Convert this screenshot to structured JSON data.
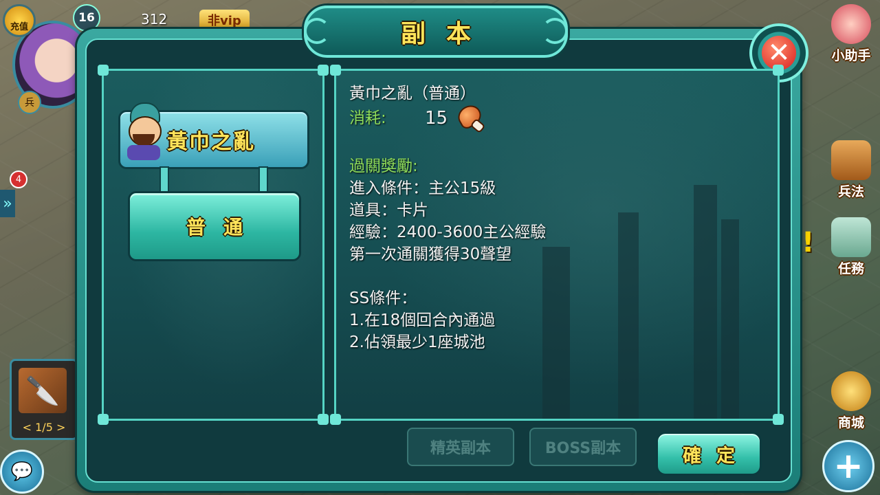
{
  "hud": {
    "recharge_label": "充值",
    "level": "16",
    "gold": "312",
    "vip_label": "非vip",
    "soldier_label": "兵",
    "badge_count": "4",
    "weapon_pager": "< 1/5 >",
    "right_items": {
      "helper": "小助手",
      "tactics": "兵法",
      "quest": "任務",
      "shop": "商城"
    }
  },
  "dialog": {
    "title": "副本",
    "close_label": "✕",
    "dungeon": {
      "name": "黃巾之亂",
      "difficulty_button": "普通"
    },
    "info": {
      "heading": "黃巾之亂（普通）",
      "cost_label": "消耗:",
      "cost_value": "15",
      "reward_title": "過關獎勵:",
      "lines": [
        "進入條件：主公15級",
        "道具：卡片",
        "經驗：2400-3600主公經驗",
        "第一次通關獲得30聲望"
      ],
      "ss_title": "SS條件：",
      "ss_lines": [
        "1.在18個回合內通過",
        "2.佔領最少1座城池"
      ]
    },
    "tabs": {
      "elite": "精英副本",
      "boss": "BOSS副本"
    },
    "confirm_label": "確定"
  },
  "colors": {
    "title_gold": "#ffe45a",
    "panel_teal": "#1b5c5e",
    "border_teal": "#6fe7d8",
    "cost_green": "#8fdc5a"
  }
}
